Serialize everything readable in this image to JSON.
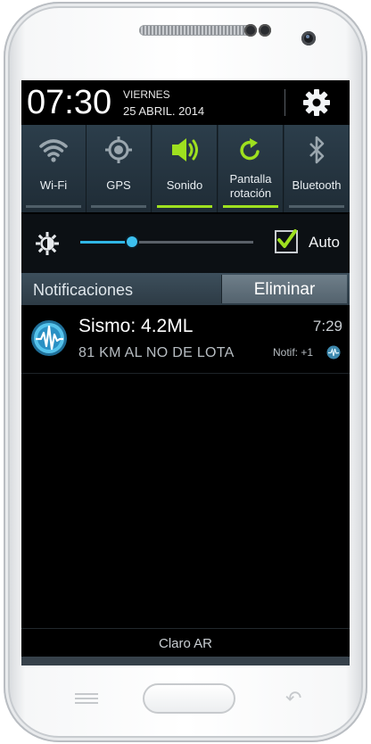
{
  "status": {
    "time": "07:30",
    "day": "VIERNES",
    "date": "25 ABRIL. 2014"
  },
  "quick_settings": [
    {
      "label": "Wi-Fi",
      "icon": "wifi-icon",
      "active": false
    },
    {
      "label": "GPS",
      "icon": "gps-icon",
      "active": false
    },
    {
      "label": "Sonido",
      "icon": "sound-icon",
      "active": true
    },
    {
      "label_line1": "Pantalla",
      "label_line2": "rotación",
      "icon": "rotation-icon",
      "active": true
    },
    {
      "label": "Bluetooth",
      "icon": "bluetooth-icon",
      "active": false
    }
  ],
  "brightness": {
    "level": 0.3,
    "auto_label": "Auto",
    "auto_checked": true
  },
  "notifications": {
    "header": "Notificaciones",
    "clear_label": "Eliminar",
    "items": [
      {
        "title": "Sismo: 4.2ML",
        "time": "7:29",
        "text": "81 KM AL NO DE LOTA",
        "count": "Notif: +1"
      }
    ]
  },
  "carrier": "Claro AR",
  "colors": {
    "accent_green": "#9ee01f",
    "slider_blue": "#3cc0ef",
    "panel_bg": "#000000"
  }
}
